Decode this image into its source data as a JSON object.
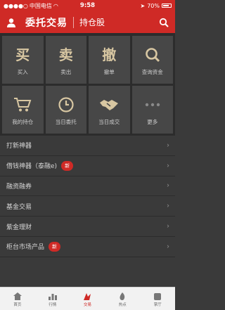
{
  "status": {
    "carrier": "中国电信",
    "time": "9:58",
    "battery": "70%"
  },
  "header": {
    "title": "委托交易",
    "subtitle": "持仓股"
  },
  "grid": [
    {
      "big": "买",
      "label": "买入"
    },
    {
      "big": "卖",
      "label": "卖出"
    },
    {
      "big": "撤",
      "label": "撤单"
    },
    {
      "icon": "search-icon",
      "label": "查询资金"
    },
    {
      "icon": "cart-icon",
      "label": "我的持仓"
    },
    {
      "icon": "clock-icon",
      "label": "当日委托"
    },
    {
      "icon": "handshake-icon",
      "label": "当日成交"
    },
    {
      "icon": "more-icon",
      "label": "更多"
    }
  ],
  "list": [
    {
      "label": "打新神器"
    },
    {
      "label": "借钱神器（泰融e)",
      "badge": "新"
    },
    {
      "label": "融资融券"
    },
    {
      "label": "基金交易"
    },
    {
      "label": "紫金理财"
    },
    {
      "label": "柜台市场产品",
      "badge": "新"
    }
  ],
  "tabs": [
    {
      "label": "首页",
      "icon": "house-icon"
    },
    {
      "label": "行情",
      "icon": "chart-icon"
    },
    {
      "label": "交易",
      "icon": "trade-icon",
      "active": true
    },
    {
      "label": "热点",
      "icon": "fire-icon"
    },
    {
      "label": "掌厅",
      "icon": "hall-icon"
    }
  ],
  "colors": {
    "accent": "#cf2a26",
    "panel": "#474747",
    "background": "#3a3a3a"
  }
}
